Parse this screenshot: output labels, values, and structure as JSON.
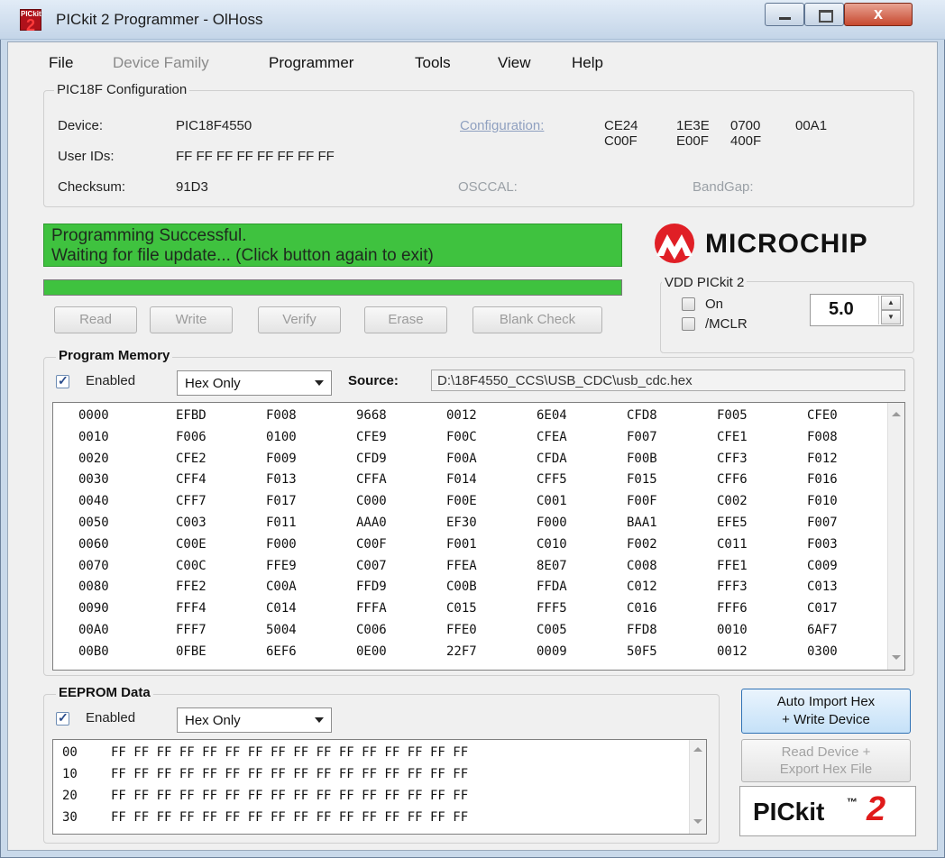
{
  "window": {
    "title": "PICkit 2 Programmer - OlHoss",
    "icon_text_small": "PICkit",
    "icon_text_big": "2",
    "close_glyph": "x"
  },
  "menu": {
    "items": [
      "File",
      "Device Family",
      "Programmer",
      "Tools",
      "View",
      "Help"
    ]
  },
  "config": {
    "group_label": "PIC18F Configuration",
    "device_label": "Device:",
    "device_value": "PIC18F4550",
    "userid_label": "User IDs:",
    "userid_value": "FF FF FF FF FF FF FF FF",
    "checksum_label": "Checksum:",
    "checksum_value": "91D3",
    "configuration_label": "Configuration:",
    "config_words": [
      "CE24",
      "1E3E",
      "0700",
      "00A1",
      "C00F",
      "E00F",
      "400F"
    ],
    "osccal_label": "OSCCAL:",
    "bandgap_label": "BandGap:"
  },
  "status": {
    "line1": "Programming Successful.",
    "line2": "Waiting for file update...  (Click button again to exit)",
    "progress": 1.0,
    "color": "#3fc23f"
  },
  "logo": {
    "microchip_text": "MICROCHIP"
  },
  "vdd": {
    "label": "VDD PICkit 2",
    "on_label": "On",
    "mclr_label": "/MCLR",
    "value": "5.0"
  },
  "actions": {
    "read": "Read",
    "write": "Write",
    "verify": "Verify",
    "erase": "Erase",
    "blank_check": "Blank Check"
  },
  "program_memory": {
    "label": "Program Memory",
    "enabled_label": "Enabled",
    "mode": "Hex Only",
    "source_label": "Source:",
    "source_path": "D:\\18F4550_CCS\\USB_CDC\\usb_cdc.hex",
    "rows": [
      [
        "0000",
        "EFBD",
        "F008",
        "9668",
        "0012",
        "6E04",
        "CFD8",
        "F005",
        "CFE0"
      ],
      [
        "0010",
        "F006",
        "0100",
        "CFE9",
        "F00C",
        "CFEA",
        "F007",
        "CFE1",
        "F008"
      ],
      [
        "0020",
        "CFE2",
        "F009",
        "CFD9",
        "F00A",
        "CFDA",
        "F00B",
        "CFF3",
        "F012"
      ],
      [
        "0030",
        "CFF4",
        "F013",
        "CFFA",
        "F014",
        "CFF5",
        "F015",
        "CFF6",
        "F016"
      ],
      [
        "0040",
        "CFF7",
        "F017",
        "C000",
        "F00E",
        "C001",
        "F00F",
        "C002",
        "F010"
      ],
      [
        "0050",
        "C003",
        "F011",
        "AAA0",
        "EF30",
        "F000",
        "BAA1",
        "EFE5",
        "F007"
      ],
      [
        "0060",
        "C00E",
        "F000",
        "C00F",
        "F001",
        "C010",
        "F002",
        "C011",
        "F003"
      ],
      [
        "0070",
        "C00C",
        "FFE9",
        "C007",
        "FFEA",
        "8E07",
        "C008",
        "FFE1",
        "C009"
      ],
      [
        "0080",
        "FFE2",
        "C00A",
        "FFD9",
        "C00B",
        "FFDA",
        "C012",
        "FFF3",
        "C013"
      ],
      [
        "0090",
        "FFF4",
        "C014",
        "FFFA",
        "C015",
        "FFF5",
        "C016",
        "FFF6",
        "C017"
      ],
      [
        "00A0",
        "FFF7",
        "5004",
        "C006",
        "FFE0",
        "C005",
        "FFD8",
        "0010",
        "6AF7"
      ],
      [
        "00B0",
        "0FBE",
        "6EF6",
        "0E00",
        "22F7",
        "0009",
        "50F5",
        "0012",
        "0300"
      ]
    ]
  },
  "eeprom": {
    "label": "EEPROM Data",
    "enabled_label": "Enabled",
    "mode": "Hex Only",
    "rows": [
      [
        "00",
        "FF FF FF FF FF FF FF FF FF FF FF FF FF FF FF FF"
      ],
      [
        "10",
        "FF FF FF FF FF FF FF FF FF FF FF FF FF FF FF FF"
      ],
      [
        "20",
        "FF FF FF FF FF FF FF FF FF FF FF FF FF FF FF FF"
      ],
      [
        "30",
        "FF FF FF FF FF FF FF FF FF FF FF FF FF FF FF FF"
      ]
    ]
  },
  "side_buttons": {
    "auto_import_line1": "Auto Import Hex",
    "auto_import_line2": "+ Write Device",
    "read_export_line1": "Read Device +",
    "read_export_line2": "Export Hex File"
  },
  "pickit_logo": {
    "text": "PICkit",
    "tm": "™",
    "num": "2"
  }
}
